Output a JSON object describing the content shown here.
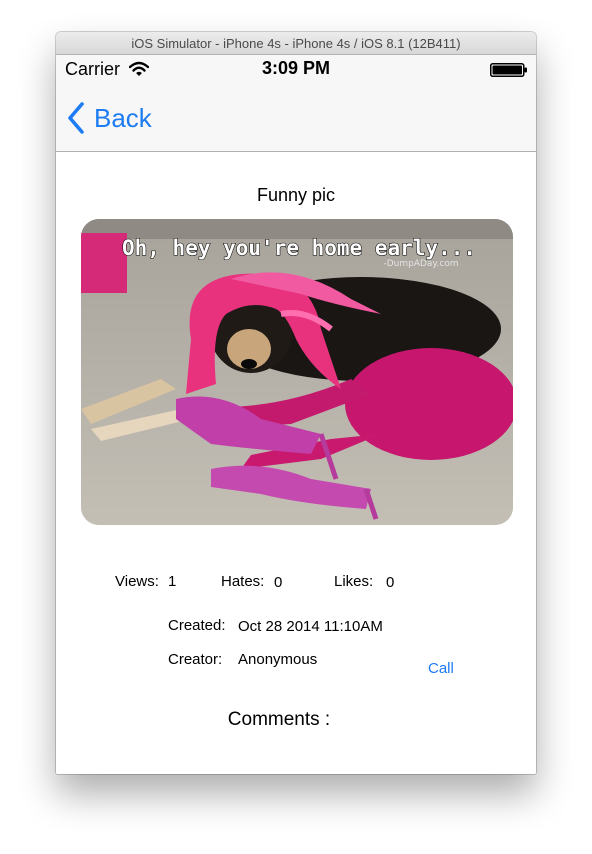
{
  "window": {
    "title": "iOS Simulator - iPhone 4s - iPhone 4s / iOS 8.1 (12B411)"
  },
  "status_bar": {
    "carrier": "Carrier",
    "time": "3:09 PM"
  },
  "nav": {
    "back_label": "Back"
  },
  "picture": {
    "title": "Funny pic",
    "caption": "Oh, hey you're home early...",
    "watermark": "-DumpADay.com"
  },
  "stats": {
    "views_label": "Views:",
    "views_value": "1",
    "hates_label": "Hates:",
    "hates_value": "0",
    "likes_label": "Likes:",
    "likes_value": "0"
  },
  "meta": {
    "created_label": "Created:",
    "created_value": "Oct 28 2014 11:10AM",
    "creator_label": "Creator:",
    "creator_value": "Anonymous",
    "call_label": "Call"
  },
  "comments": {
    "label": "Comments :"
  },
  "colors": {
    "ios_blue": "#1e7cf2",
    "nav_bg": "#f7f7f7",
    "wig_pink": "#e8327e"
  },
  "icons": [
    "wifi-icon",
    "battery-icon",
    "back-chevron-icon"
  ]
}
